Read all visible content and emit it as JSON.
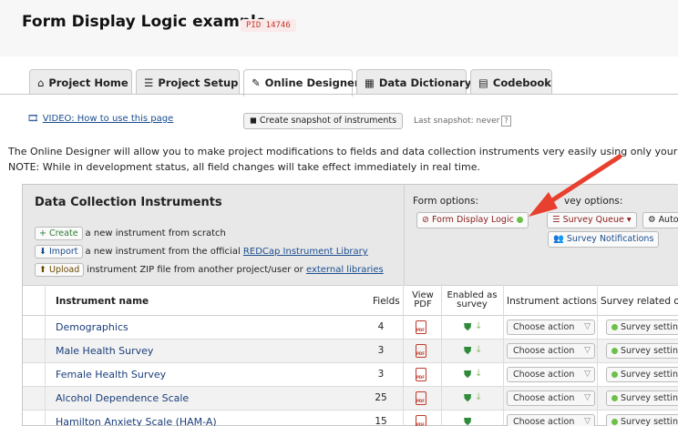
{
  "header": {
    "title": "Form Display Logic example",
    "pid": "PID 14746"
  },
  "tabs": [
    {
      "label": "Project Home",
      "icon": "home-icon"
    },
    {
      "label": "Project Setup",
      "icon": "list-icon"
    },
    {
      "label": "Online Designer",
      "icon": "edit-icon",
      "active": true
    },
    {
      "label": "Data Dictionary",
      "icon": "table-icon"
    },
    {
      "label": "Codebook",
      "icon": "book-icon"
    }
  ],
  "toolbar": {
    "video_link": "VIDEO: How to use this page",
    "snapshot_button": "Create snapshot of instruments",
    "last_snapshot": "Last snapshot: never",
    "help_glyph": "?"
  },
  "intro": {
    "line1": "The Online Designer will allow you to make project modifications to fields and data collection instruments very easily using only your w",
    "line2": "NOTE: While in development status, all field changes will take effect immediately in real time."
  },
  "panel": {
    "title": "Data Collection Instruments",
    "create": {
      "button": "+ Create",
      "text": "a new instrument from scratch"
    },
    "import": {
      "button": "Import",
      "text": "a new instrument from the official",
      "link": "REDCap Instrument Library"
    },
    "upload": {
      "button": "Upload",
      "text": "instrument ZIP file from another project/user or",
      "link": "external libraries"
    },
    "form_options_label": "Form options:",
    "survey_options_label": "vey options:",
    "form_display_logic": "Form Display Logic",
    "survey_queue": "Survey Queue",
    "auto_label": "Auto",
    "survey_notifications": "Survey Notifications"
  },
  "table": {
    "headers": {
      "name": "Instrument name",
      "fields": "Fields",
      "view_pdf_1": "View",
      "view_pdf_2": "PDF",
      "enabled_1": "Enabled as",
      "enabled_2": "survey",
      "actions": "Instrument actions",
      "survey_related": "Survey related op"
    },
    "rows": [
      {
        "name": "Demographics",
        "fields": "4",
        "action": "Choose action",
        "survey": "Survey settings"
      },
      {
        "name": "Male Health Survey",
        "fields": "3",
        "action": "Choose action",
        "survey": "Survey settings"
      },
      {
        "name": "Female Health Survey",
        "fields": "3",
        "action": "Choose action",
        "survey": "Survey settings"
      },
      {
        "name": "Alcohol Dependence Scale",
        "fields": "25",
        "action": "Choose action",
        "survey": "Survey settings"
      },
      {
        "name": "Hamilton Anxiety Scale (HAM-A)",
        "fields": "15",
        "action": "Choose action",
        "survey": "Survey settings"
      }
    ]
  },
  "colors": {
    "accent_red": "#e8402e",
    "link_blue": "#1a3e7a",
    "pid_red": "#c0392b"
  }
}
